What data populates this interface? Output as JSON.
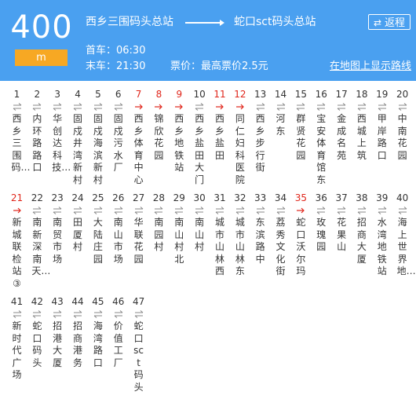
{
  "route": {
    "number": "400",
    "unit": "m"
  },
  "terminals": {
    "from": "西乡三围码头总站",
    "to": "蛇口sct码头总站"
  },
  "back_button": "返程",
  "first_bus": "首车：06:30",
  "last_bus": "末车：21:30",
  "price": "票价：最高票价2.5元",
  "map_link": "在地图上显示路线",
  "colors": {
    "header": "#4aa0f0",
    "unit_badge": "#f7a823",
    "highlight": "#e0261b"
  },
  "stops": [
    {
      "index": "1",
      "name": "西乡三围码…",
      "highlight": false
    },
    {
      "index": "2",
      "name": "内环路路口",
      "highlight": false
    },
    {
      "index": "3",
      "name": "华创达科技…",
      "highlight": false
    },
    {
      "index": "4",
      "name": "固戍井湾新村",
      "highlight": false
    },
    {
      "index": "5",
      "name": "固戍海滨新村",
      "highlight": false
    },
    {
      "index": "6",
      "name": "固戍污水厂",
      "highlight": false
    },
    {
      "index": "7",
      "name": "西乡体育中心",
      "highlight": true
    },
    {
      "index": "8",
      "name": "锦欣花园",
      "highlight": true
    },
    {
      "index": "9",
      "name": "西乡地铁站",
      "highlight": true
    },
    {
      "index": "10",
      "name": "西乡盐田大门",
      "highlight": false
    },
    {
      "index": "11",
      "name": "西乡盐田",
      "highlight": true
    },
    {
      "index": "12",
      "name": "同仁妇科医院",
      "highlight": true
    },
    {
      "index": "13",
      "name": "西乡步行街",
      "highlight": false
    },
    {
      "index": "14",
      "name": "河东",
      "highlight": false
    },
    {
      "index": "15",
      "name": "群贤花园",
      "highlight": false
    },
    {
      "index": "16",
      "name": "宝安体育馆东",
      "highlight": false
    },
    {
      "index": "17",
      "name": "金成名苑",
      "highlight": false
    },
    {
      "index": "18",
      "name": "西城上筑",
      "highlight": false
    },
    {
      "index": "19",
      "name": "甲岸路口",
      "highlight": false
    },
    {
      "index": "20",
      "name": "中南花园",
      "highlight": false
    },
    {
      "index": "21",
      "name": "新城联检站③",
      "highlight": true
    },
    {
      "index": "22",
      "name": "南新深南天…",
      "highlight": false
    },
    {
      "index": "23",
      "name": "南贸市场",
      "highlight": false
    },
    {
      "index": "24",
      "name": "田厦村",
      "highlight": false
    },
    {
      "index": "25",
      "name": "大陆庄园",
      "highlight": false
    },
    {
      "index": "26",
      "name": "南山市场",
      "highlight": false
    },
    {
      "index": "27",
      "name": "华联花园",
      "highlight": false
    },
    {
      "index": "28",
      "name": "南园村",
      "highlight": false
    },
    {
      "index": "29",
      "name": "南山村北",
      "highlight": false
    },
    {
      "index": "30",
      "name": "南山村",
      "highlight": false
    },
    {
      "index": "31",
      "name": "城市山林西",
      "highlight": false
    },
    {
      "index": "32",
      "name": "城市山林东",
      "highlight": false
    },
    {
      "index": "33",
      "name": "东滨路中",
      "highlight": false
    },
    {
      "index": "34",
      "name": "荔秀文化街",
      "highlight": false
    },
    {
      "index": "35",
      "name": "蛇口沃尔玛",
      "highlight": true
    },
    {
      "index": "36",
      "name": "玫瑰园",
      "highlight": false
    },
    {
      "index": "37",
      "name": "花果山",
      "highlight": false
    },
    {
      "index": "38",
      "name": "招商大厦",
      "highlight": false
    },
    {
      "index": "39",
      "name": "水湾地铁站",
      "highlight": false
    },
    {
      "index": "40",
      "name": "海上世界地…",
      "highlight": false
    },
    {
      "index": "41",
      "name": "新时代广场",
      "highlight": false
    },
    {
      "index": "42",
      "name": "蛇口码头",
      "highlight": false
    },
    {
      "index": "43",
      "name": "招港大厦",
      "highlight": false
    },
    {
      "index": "44",
      "name": "招商港务",
      "highlight": false
    },
    {
      "index": "45",
      "name": "海湾路口",
      "highlight": false
    },
    {
      "index": "46",
      "name": "价值工厂",
      "highlight": false
    },
    {
      "index": "47",
      "name": "蛇口sct码头",
      "highlight": false
    }
  ]
}
